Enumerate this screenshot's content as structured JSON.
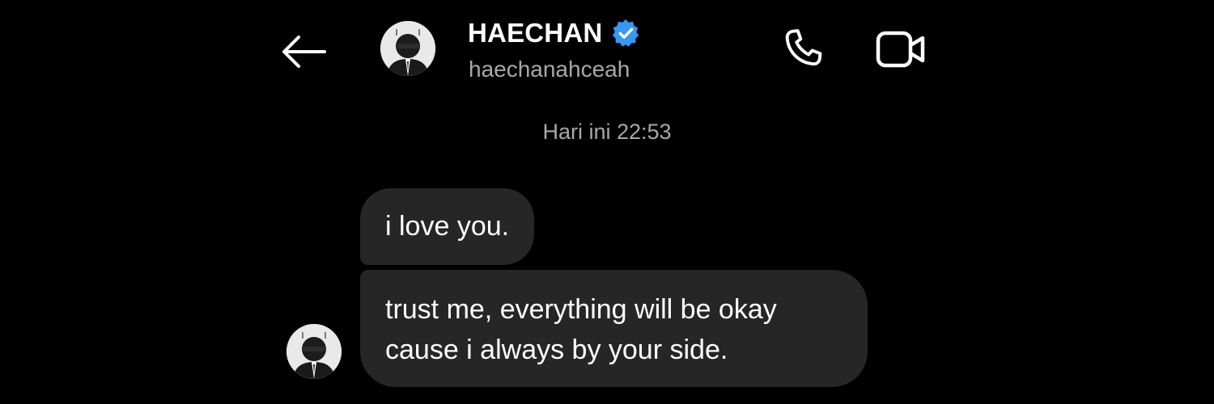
{
  "header": {
    "back_icon": "arrow-left-icon",
    "contact_name": "HAECHAN",
    "verified_icon": "verified-badge-icon",
    "verified_color": "#3897f0",
    "contact_handle": "haechanahceah",
    "phone_icon": "phone-icon",
    "video_icon": "video-camera-icon"
  },
  "conversation": {
    "timestamp": "Hari ini 22:53",
    "messages": [
      {
        "text": "i love you."
      },
      {
        "text": "trust me, everything will be okay cause i always by your side."
      }
    ]
  },
  "colors": {
    "background": "#000000",
    "bubble": "#262626",
    "secondary_text": "#a8a8a8"
  }
}
